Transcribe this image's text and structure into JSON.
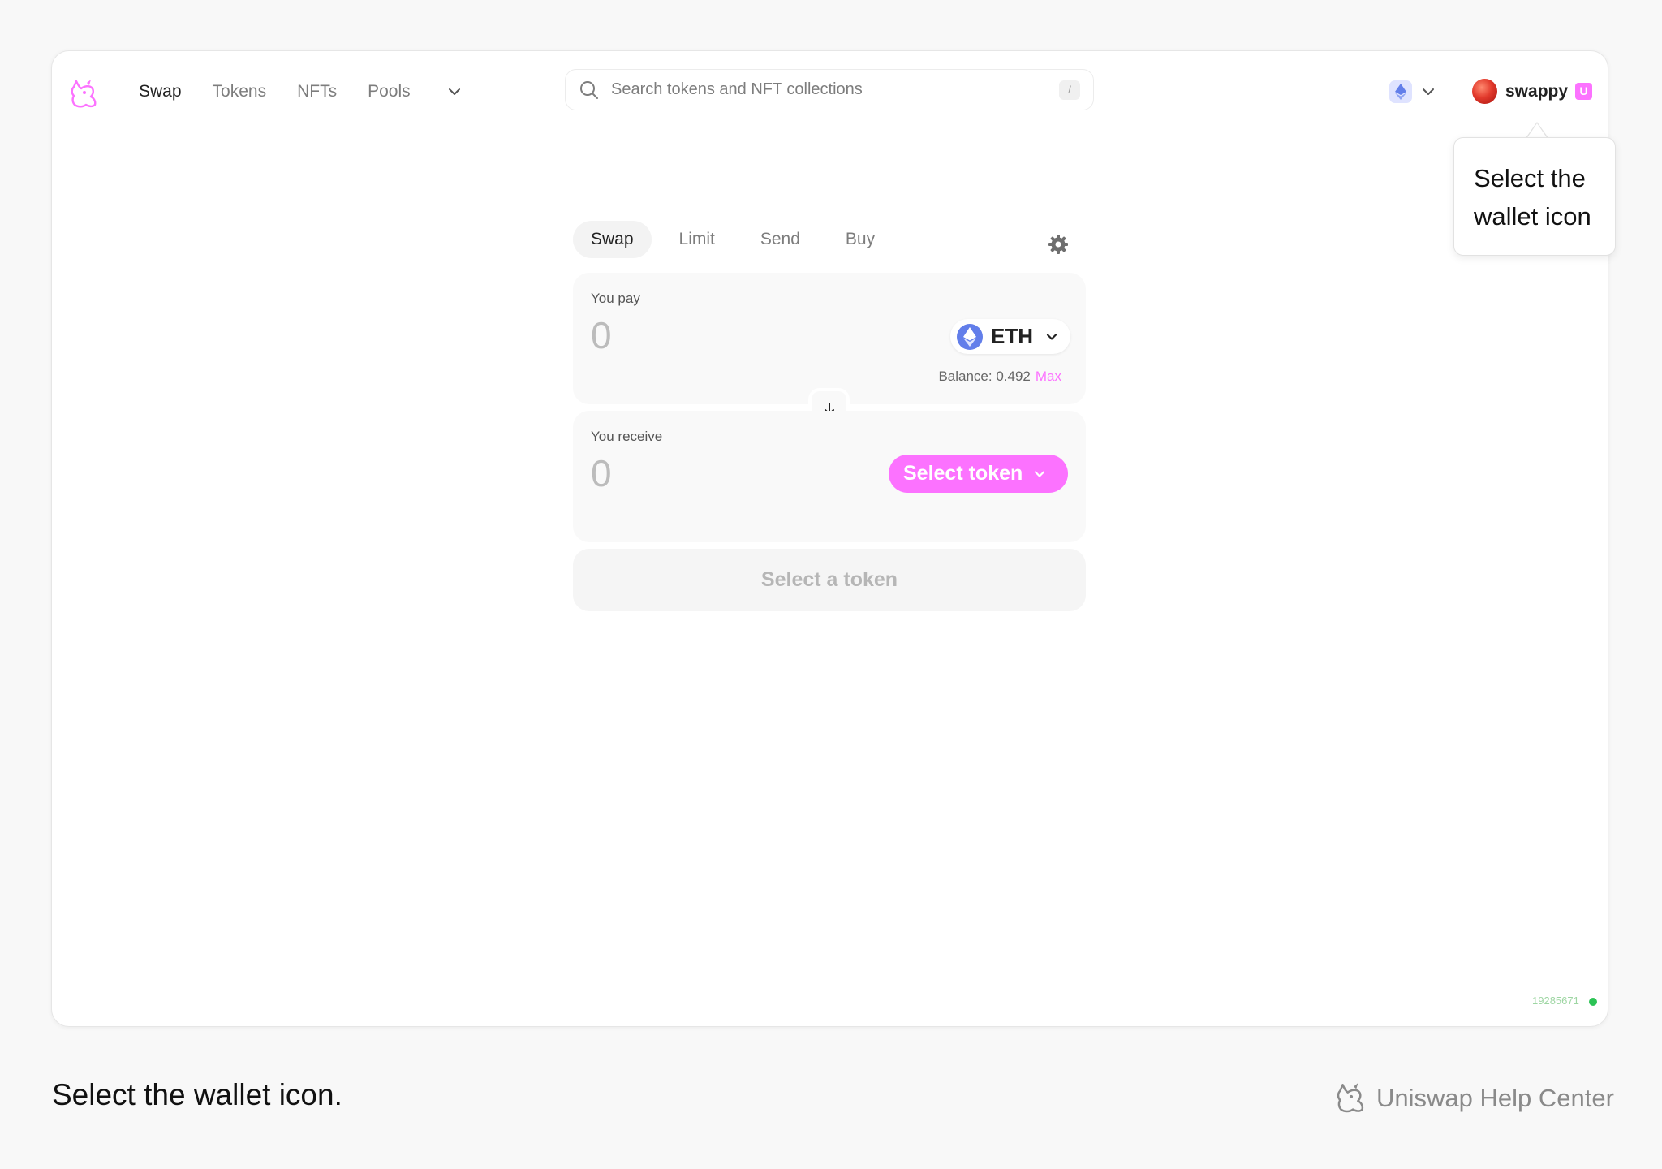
{
  "nav": {
    "items": [
      "Swap",
      "Tokens",
      "NFTs",
      "Pools"
    ],
    "active_index": 0
  },
  "search": {
    "placeholder": "Search tokens and NFT collections",
    "shortcut": "/"
  },
  "account": {
    "name": "swappy",
    "badge": "U"
  },
  "tooltip": {
    "text": "Select the wallet icon"
  },
  "swap_tabs": {
    "items": [
      "Swap",
      "Limit",
      "Send",
      "Buy"
    ],
    "active_index": 0
  },
  "pay": {
    "label": "You pay",
    "amount": "0",
    "token": "ETH",
    "balance_label": "Balance: 0.492",
    "max_label": "Max"
  },
  "receive": {
    "label": "You receive",
    "amount": "0",
    "select_label": "Select token"
  },
  "cta": {
    "label": "Select a token"
  },
  "footer": {
    "block_number": "19285671"
  },
  "caption": {
    "text": "Select the wallet icon.",
    "brand": "Uniswap Help Center"
  },
  "colors": {
    "accent_pink": "#fc72ff",
    "eth_blue": "#627eea",
    "status_green": "#2cc355"
  }
}
